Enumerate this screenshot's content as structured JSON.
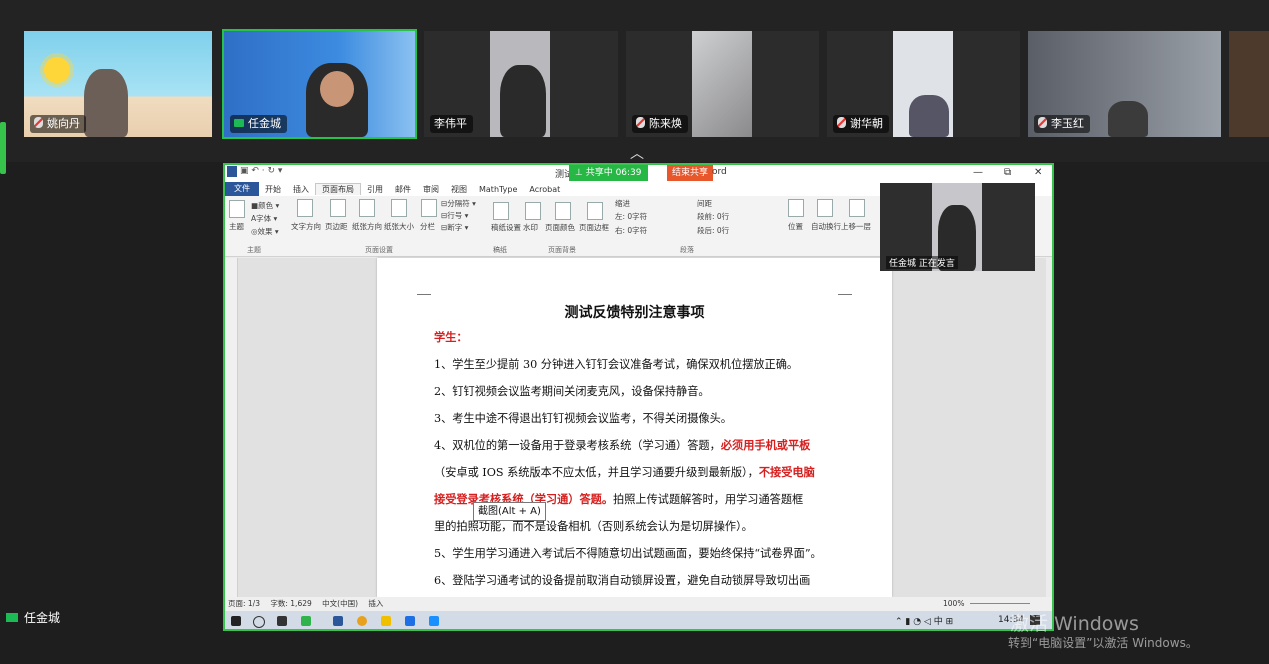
{
  "participants": [
    {
      "name": "姚向丹",
      "muted": true
    },
    {
      "name": "任金城",
      "muted": false,
      "active": true
    },
    {
      "name": "李伟平",
      "muted": false
    },
    {
      "name": "陈来焕",
      "muted": true
    },
    {
      "name": "谢华朝",
      "muted": true
    },
    {
      "name": "李玉红",
      "muted": true
    }
  ],
  "share": {
    "status": "共享中 06:39",
    "stop_label": "结束共享",
    "title_left": "测试",
    "title_right": "ord"
  },
  "ribbon_tabs": [
    "文件",
    "开始",
    "插入",
    "页面布局",
    "引用",
    "邮件",
    "审阅",
    "视图",
    "MathType",
    "Acrobat"
  ],
  "ribbon": {
    "theme": "主题",
    "colors": "颜色",
    "fonts": "字体",
    "effects": "效果",
    "text_dir": "文字方向",
    "margins": "页边距",
    "orientation": "纸张方向",
    "size": "纸张大小",
    "columns": "分栏",
    "breaks": "分隔符",
    "line_numbers": "行号",
    "hyphenation": "断字",
    "watermark": "水印",
    "page_color": "页面颜色",
    "page_border": "页面边框",
    "indent": "缩进",
    "left_indent": "左: 0字符",
    "right_indent": "右: 0字符",
    "spacing": "间距",
    "before": "段前: 0行",
    "after": "段后: 0行",
    "position": "位置",
    "wrap": "自动换行",
    "bring_forward": "上移一层",
    "g_theme": "主题",
    "g_page_setup": "页面设置",
    "g_draft": "稿纸",
    "g_page_bg": "页面背景",
    "g_paragraph": "段落",
    "draft_paper": "稿纸设置"
  },
  "document": {
    "title": "测试反馈特别注意事项",
    "section": "学生：",
    "lines": [
      "1、学生至少提前 30 分钟进入钉钉会议准备考试，确保双机位摆放正确。",
      "2、钉钉视频会议监考期间关闭麦克风，设备保持静音。",
      "3、考生中途不得退出钉钉视频会议监考，不得关闭摄像头。"
    ],
    "line4_a": "4、双机位的第一设备用于登录考核系统（学习通）答题，",
    "line4_b": "必须用手机或平板",
    "line5_a": "（安卓或 IOS 系统版本不应太低，并且学习通要升级到最新版），",
    "line5_b": "不接受电脑",
    "line6_a": "接受登录考核系统（学习通）答题。",
    "line6_b": "拍照上传试题解答时，用学习通答题框",
    "line7": "里的拍照功能，而不是设备相机（否则系统会认为是切屏操作）。",
    "line8": "5、学生用学习通进入考试后不得随意切出试题画面，要始终保持“试卷界面”。",
    "line9": "6、登陆学习通考试的设备提前取消自动锁屏设置，避免自动锁屏导致切出画"
  },
  "status_bar": {
    "page": "页面: 1/3",
    "words": "字数: 1,629",
    "lang": "中文(中国)",
    "mode": "插入",
    "zoom": "100%"
  },
  "taskbar": {
    "time": "14:34",
    "ime": "中"
  },
  "pip": {
    "label": "任金城 正在发言"
  },
  "tooltip": "截图(Alt + A)",
  "self_name": "任金城",
  "watermark": {
    "line1": "激活 Windows",
    "line2": "转到“电脑设置”以激活 Windows。"
  }
}
